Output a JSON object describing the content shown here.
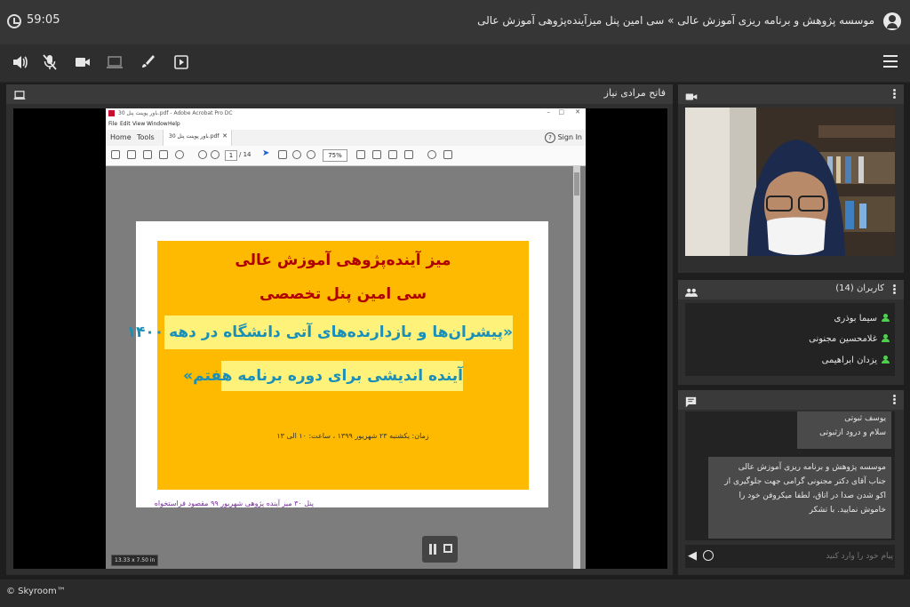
{
  "header": {
    "timer": "59:05",
    "room_title": "موسسه پژوهش و برنامه ریزی آموزش عالی » سی امین پنل میزآینده‌پژوهی آموزش عالی"
  },
  "toolbar": {
    "icons": [
      "speaker-icon",
      "mic-muted-icon",
      "camera-icon",
      "screen-share-icon",
      "whiteboard-icon",
      "file-present-icon",
      "menu-icon"
    ]
  },
  "main_panel": {
    "presenter": "فاتح مرادی نیاز"
  },
  "acrobat": {
    "title": "باور پوینت پنل 30.pdf - Adobe Acrobat Pro DC",
    "menu": [
      "File",
      "Edit",
      "View",
      "Window",
      "Help"
    ],
    "tab_home": "Home",
    "tab_tools": "Tools",
    "doc_tab": "باور پوینت پنل 30.pdf",
    "sign_in": "Sign In",
    "page_current": "1",
    "page_total": "/ 14",
    "zoom": "75%",
    "page_size": "13.33 x 7.50 in"
  },
  "slide": {
    "line1": "میز آینده‌پژوهی آموزش عالی",
    "line2": "سی امین پنل تخصصی",
    "line3": "«پیشران‌ها و بازدارنده‌های آتی دانشگاه در دهه ۱۴۰۰",
    "line4": "آینده اندیشی برای دوره برنامه هفتم»",
    "date": "زمان: یکشنبه ۲۳ شهریور ۱۳۹۹ ، ساعت: ۱۰ الی ۱۳",
    "footer": "پنل ۳۰ میز آینده پژوهی شهریور ۹۹ مقصود فراستخواه"
  },
  "users": {
    "title": "کاربران (14)",
    "list": [
      "سیما بوذری",
      "غلامحسین مجنونی",
      "یزدان ابراهیمی"
    ]
  },
  "chat": {
    "messages": [
      {
        "sender": "یوسف ثبوتی",
        "text": "سلام و درود ازثبوتی"
      },
      {
        "sender": "موسسه پژوهش و برنامه ریزی آموزش عالی",
        "text": "جناب آقای دکتر مجنونی گرامی جهت جلوگیری از اکو شدن صدا در اتاق، لطفا میکروفن خود را خاموش نمایید. با تشکر"
      }
    ],
    "input_placeholder": "پیام خود را وارد کنید"
  },
  "footer": {
    "brand": "© Skyroom™"
  }
}
